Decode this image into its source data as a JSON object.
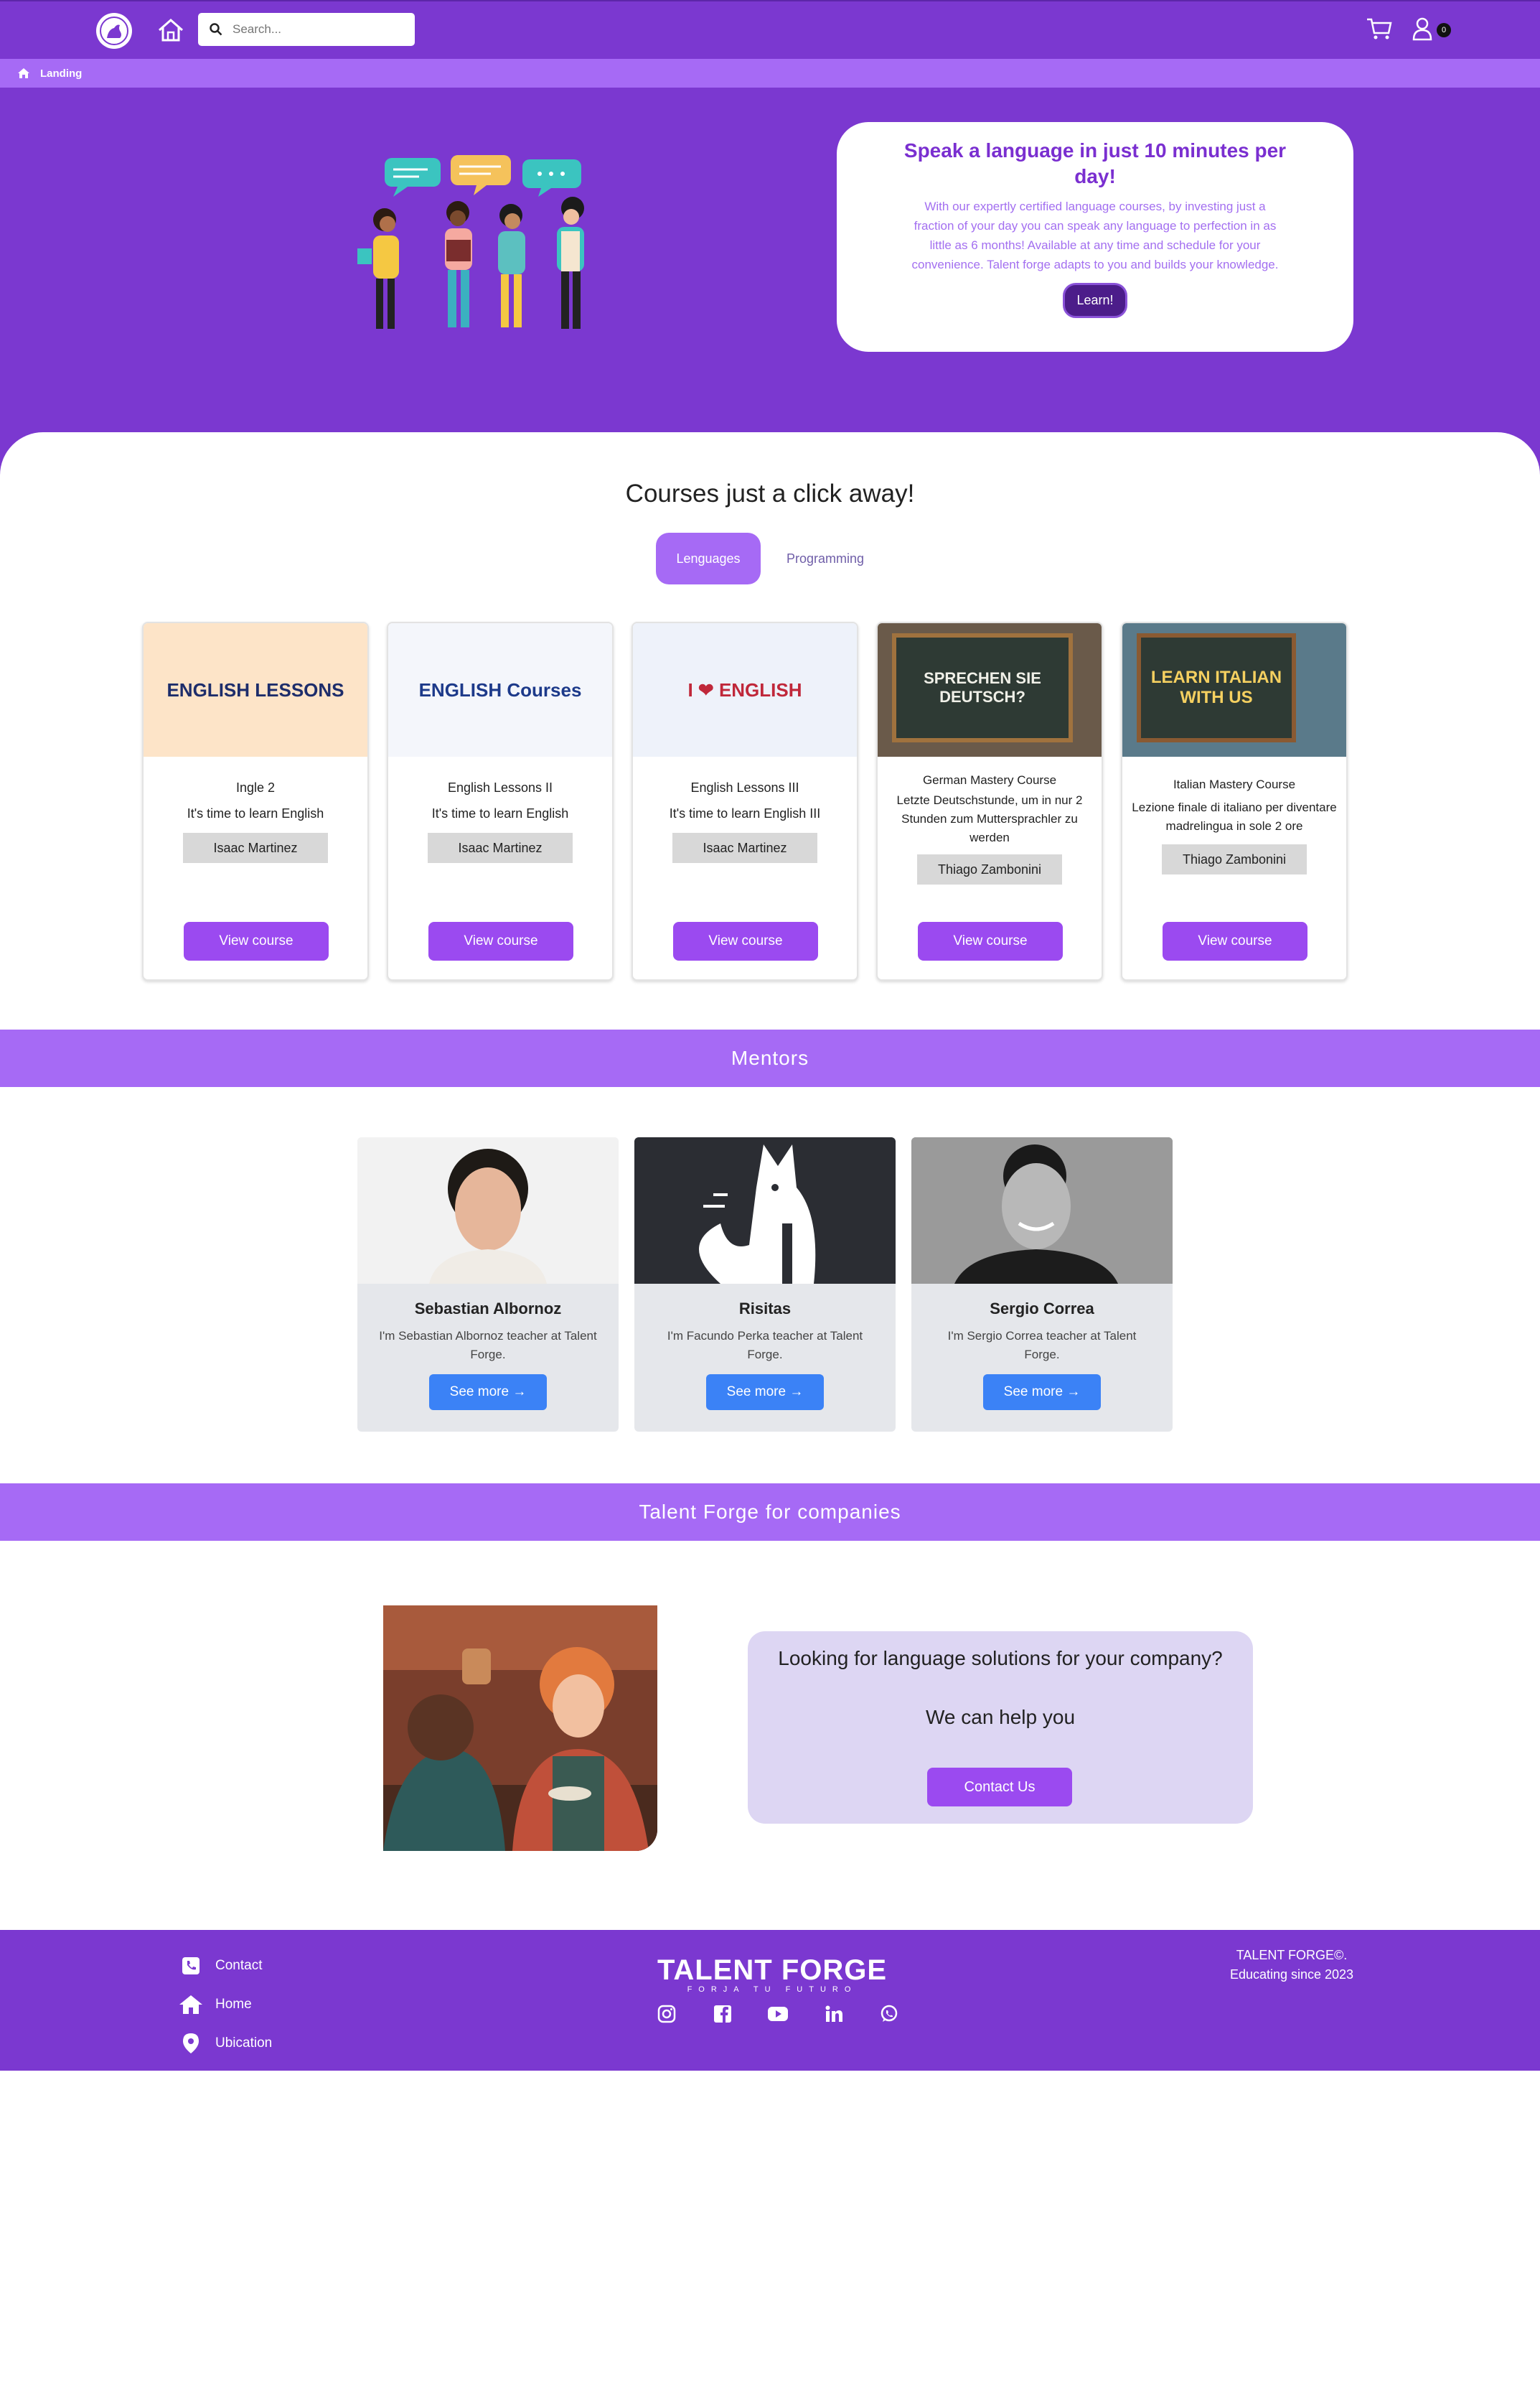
{
  "nav": {
    "search_placeholder": "Search...",
    "cart_badge": "0"
  },
  "breadcrumb": {
    "current": "Landing"
  },
  "hero": {
    "title": "Speak a language in just 10 minutes per day!",
    "text": "With our expertly certified language courses, by investing just a fraction of your day you can speak any language to perfection in as little as 6 months! Available at any time and schedule for your convenience. Talent forge adapts to you and builds your knowledge.",
    "button": "Learn!"
  },
  "courses": {
    "title": "Courses just a click away!",
    "tabs": [
      "Lenguages",
      "Programming"
    ],
    "items": [
      {
        "thumb_text": "ENGLISH LESSONS",
        "title": "Ingle 2",
        "subtitle": "It's time to learn English",
        "mentor": "Isaac Martinez",
        "button": "View course"
      },
      {
        "thumb_text": "ENGLISH Courses",
        "title": "English Lessons II",
        "subtitle": "It's time to learn English",
        "mentor": "Isaac Martinez",
        "button": "View course"
      },
      {
        "thumb_text": "I ❤ ENGLISH",
        "title": "English Lessons III",
        "subtitle": "It's time to learn English III",
        "mentor": "Isaac Martinez",
        "button": "View course"
      },
      {
        "thumb_text": "SPRECHEN SIE DEUTSCH?",
        "title": "German Mastery Course",
        "subtitle": "Letzte Deutschstunde, um in nur 2 Stunden zum Muttersprachler zu werden",
        "mentor": "Thiago Zambonini",
        "button": "View course"
      },
      {
        "thumb_text": "LEARN ITALIAN WITH US",
        "title": "Italian Mastery Course",
        "subtitle": "Lezione finale di italiano per diventare madrelingua in sole 2 ore",
        "mentor": "Thiago Zambonini",
        "button": "View course"
      }
    ]
  },
  "mentors": {
    "title": "Mentors",
    "items": [
      {
        "name": "Sebastian Albornoz",
        "desc": "I'm Sebastian Albornoz teacher at Talent Forge.",
        "button": "See more →"
      },
      {
        "name": "Risitas",
        "desc": "I'm Facundo Perka teacher at Talent Forge.",
        "button": "See more →"
      },
      {
        "name": "Sergio Correa",
        "desc": "I'm Sergio Correa teacher at Talent Forge.",
        "button": "See more →"
      }
    ]
  },
  "companies": {
    "title": "Talent Forge for companies",
    "question": "Looking for language solutions for your company?",
    "help": "We can help you",
    "button": "Contact Us"
  },
  "footer": {
    "links": [
      "Contact",
      "Home",
      "Ubication"
    ],
    "brand": "TALENT FORGE",
    "tagline": "FORJA TU FUTURO",
    "copyright": "TALENT FORGE©.",
    "since": "Educating since 2023",
    "socials": [
      "instagram-icon",
      "facebook-icon",
      "youtube-icon",
      "linkedin-icon",
      "whatsapp-icon"
    ]
  },
  "colors": {
    "primary": "#7b38d0",
    "accent": "#a66af5",
    "button": "#9b4af0",
    "mentor_button": "#3b82f6"
  }
}
